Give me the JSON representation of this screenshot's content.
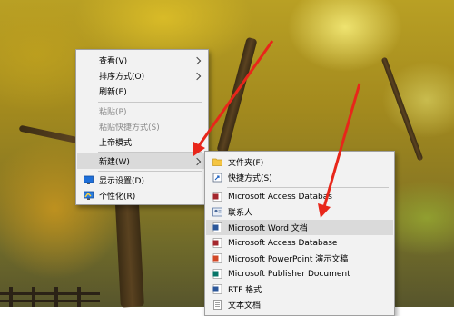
{
  "desktop_menu": {
    "items": [
      {
        "label": "查看(V)"
      },
      {
        "label": "排序方式(O)"
      },
      {
        "label": "刷新(E)"
      },
      {
        "label": "粘贴(P)"
      },
      {
        "label": "粘贴快捷方式(S)"
      },
      {
        "label": "上帝模式"
      },
      {
        "label": "新建(W)"
      },
      {
        "label": "显示设置(D)"
      },
      {
        "label": "个性化(R)"
      }
    ]
  },
  "new_submenu": {
    "items": [
      {
        "label": "文件夹(F)",
        "icon": "folder-icon"
      },
      {
        "label": "快捷方式(S)",
        "icon": "shortcut-icon"
      },
      {
        "label": "Microsoft Access Databas",
        "icon": "access-icon"
      },
      {
        "label": "联系人",
        "icon": "contact-icon"
      },
      {
        "label": "Microsoft Word 文档",
        "icon": "word-icon"
      },
      {
        "label": "Microsoft Access Database",
        "icon": "access-icon"
      },
      {
        "label": "Microsoft PowerPoint 演示文稿",
        "icon": "powerpoint-icon"
      },
      {
        "label": "Microsoft Publisher Document",
        "icon": "publisher-icon"
      },
      {
        "label": "RTF 格式",
        "icon": "rtf-icon"
      },
      {
        "label": "文本文档",
        "icon": "text-document-icon"
      }
    ]
  },
  "colors": {
    "annotation_arrow": "#e8261a",
    "menu_background": "#f2f2f2",
    "highlight": "#dadada"
  }
}
